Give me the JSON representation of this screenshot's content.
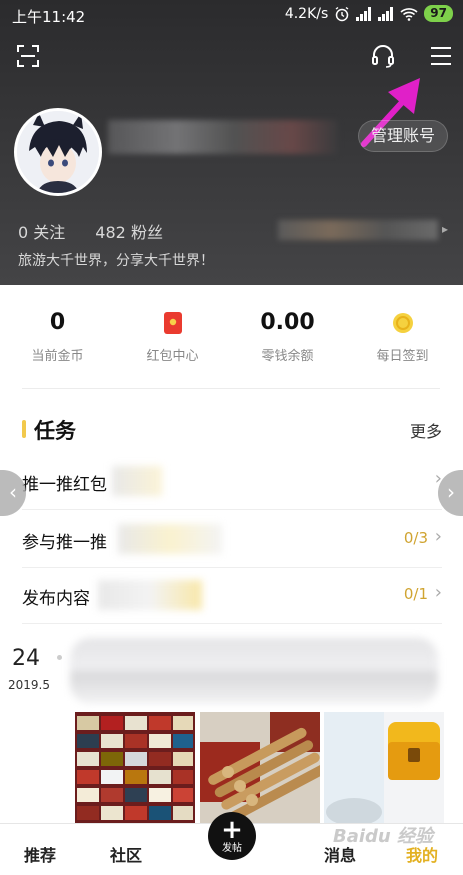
{
  "status_bar": {
    "time": "上午11:42",
    "speed": "4.2K/s",
    "network": "HD",
    "battery": "97"
  },
  "profile": {
    "manage_account": "管理账号",
    "following_count": "0",
    "following_label": "关注",
    "fans_count": "482",
    "fans_label": "粉丝",
    "bio": "旅游大千世界，分享大千世界！"
  },
  "wallet": {
    "items": [
      {
        "value": "0",
        "label": "当前金币"
      },
      {
        "icon": "red-envelope-icon",
        "label": "红包中心"
      },
      {
        "value": "0.00",
        "label": "零钱余额"
      },
      {
        "icon": "coin-icon",
        "label": "每日签到"
      }
    ]
  },
  "tasks": {
    "title": "任务",
    "more": "更多",
    "items": [
      {
        "name": "推一推红包",
        "progress": ""
      },
      {
        "name": "参与推一推",
        "progress": "0/3"
      },
      {
        "name": "发布内容",
        "progress": "0/1"
      }
    ]
  },
  "feed": {
    "day": "24",
    "year_month": "2019.5"
  },
  "bottom_nav": {
    "recommend": "推荐",
    "community": "社区",
    "post": "发帖",
    "messages": "消息",
    "mine": "我的"
  },
  "colors": {
    "accent": "#e3b122",
    "task_bar": "#f2c94c",
    "arrow": "#e020c8",
    "battery": "#7ed14b"
  },
  "watermark": "Baidu 经验"
}
